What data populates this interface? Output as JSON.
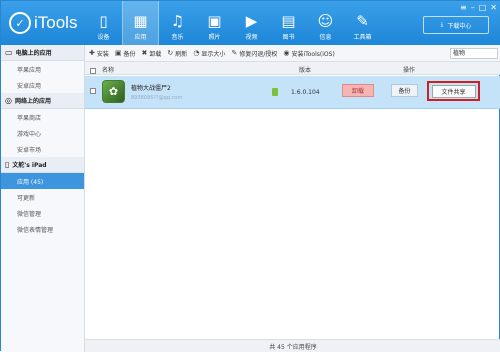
{
  "app": {
    "logo_text": "iTools"
  },
  "nav": [
    {
      "label": "设备",
      "icon": "phone-icon",
      "glyph": "▯"
    },
    {
      "label": "应用",
      "icon": "apps-icon",
      "glyph": "▦"
    },
    {
      "label": "音乐",
      "icon": "music-icon",
      "glyph": "♫"
    },
    {
      "label": "照片",
      "icon": "photo-icon",
      "glyph": "▣"
    },
    {
      "label": "视频",
      "icon": "video-icon",
      "glyph": "▶"
    },
    {
      "label": "图书",
      "icon": "book-icon",
      "glyph": "▤"
    },
    {
      "label": "信息",
      "icon": "person-icon",
      "glyph": "☺"
    },
    {
      "label": "工具箱",
      "icon": "wrench-icon",
      "glyph": "✎"
    }
  ],
  "download": {
    "label": "下载中心"
  },
  "sidebar": {
    "sections": [
      {
        "title": "电脑上的应用",
        "icon": "monitor-icon",
        "items": [
          "苹果应用",
          "安卓应用"
        ]
      },
      {
        "title": "网络上的应用",
        "icon": "globe-icon",
        "items": [
          "苹果商店",
          "游戏中心",
          "安卓市场"
        ]
      },
      {
        "title": "文舵's iPad",
        "icon": "ipad-icon",
        "items": [
          "应用 (45)",
          "可更新",
          "微信管理",
          "微信表情管理"
        ]
      }
    ],
    "active_item": "应用 (45)"
  },
  "toolbar": {
    "install": "安装",
    "backup": "备份",
    "uninstall": "卸载",
    "refresh": "刷新",
    "show_size": "显示大小",
    "fix_flash": "修复闪退/授权",
    "install_itools": "安装iTools(iOS)",
    "search_value": "植物"
  },
  "table": {
    "col_name": "名称",
    "col_version": "版本",
    "col_actions": "操作"
  },
  "row": {
    "name": "植物大战僵尸2",
    "account": "8938095??@qq.com",
    "version": "1.6.0.104",
    "uninstall": "卸载",
    "backup": "备份",
    "share": "文件共享"
  },
  "footer": {
    "text": "共 45 个应用程序"
  },
  "colors": {
    "accent": "#1d86d7",
    "selected_row": "#c4e2f8",
    "highlight": "#d01f1f"
  }
}
